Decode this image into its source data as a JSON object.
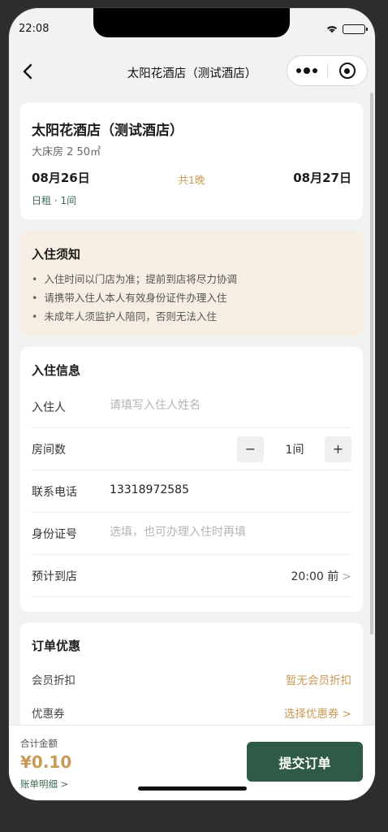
{
  "status_bar": {
    "time": "22:08"
  },
  "navbar": {
    "title": "太阳花酒店（测试酒店）",
    "icons": {
      "back": "chevron-left-icon",
      "more": "more-dots-icon",
      "close": "target-circle-icon"
    }
  },
  "hotel": {
    "name": "太阳花酒店（测试酒店）",
    "room_type": "大床房 2 50㎡",
    "check_in": "08月26日",
    "nights": "共1晚",
    "check_out": "08月27日",
    "rent_info": "日租 · 1间"
  },
  "notice": {
    "title": "入住须知",
    "items": [
      "入住时间以门店为准；提前到店将尽力协调",
      "请携带入住人本人有效身份证件办理入住",
      "未成年人须监护人陪同，否则无法入住"
    ]
  },
  "checkin_info": {
    "title": "入住信息",
    "guest_label": "入住人",
    "guest_placeholder": "请填写入住人姓名",
    "rooms_label": "房间数",
    "rooms_minus": "−",
    "rooms_value": "1间",
    "rooms_plus": "+",
    "phone_label": "联系电话",
    "phone_value": "13318972585",
    "id_label": "身份证号",
    "id_placeholder": "选填，也可办理入住时再填",
    "arrive_label": "预计到店",
    "arrive_value": "20:00 前",
    "arrive_chevron": ">"
  },
  "discount": {
    "title": "订单优惠",
    "member_label": "会员折扣",
    "member_value": "暂无会员折扣",
    "coupon_label": "优惠券",
    "coupon_value": "选择优惠券 >"
  },
  "footer": {
    "total_label": "合计金额",
    "total_amount": "¥0.10",
    "bill_detail": "账单明细 >",
    "submit": "提交订单"
  },
  "colors": {
    "accent_gold": "#c79a55",
    "primary_green": "#2f5a45",
    "notice_bg": "#f6eee3"
  }
}
